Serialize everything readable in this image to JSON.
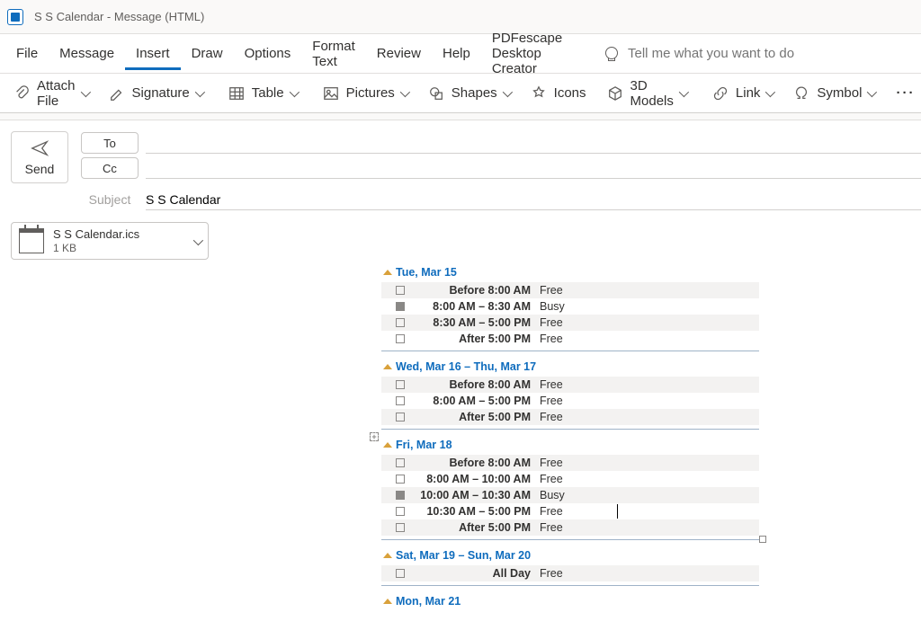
{
  "titlebar": {
    "text": "S S Calendar  -  Message (HTML)"
  },
  "menu": {
    "file": "File",
    "message": "Message",
    "insert": "Insert",
    "draw": "Draw",
    "options": "Options",
    "format_text": "Format Text",
    "review": "Review",
    "help": "Help",
    "pdfescape": "PDFescape Desktop Creator",
    "tellme_placeholder": "Tell me what you want to do"
  },
  "ribbon": {
    "attach_file": "Attach File",
    "signature": "Signature",
    "table": "Table",
    "pictures": "Pictures",
    "shapes": "Shapes",
    "icons": "Icons",
    "models_3d": "3D Models",
    "link": "Link",
    "symbol": "Symbol"
  },
  "compose": {
    "send": "Send",
    "to": "To",
    "cc": "Cc",
    "subject_label": "Subject",
    "subject_value": "S S Calendar"
  },
  "attachment": {
    "name": "S S Calendar.ics",
    "size": "1 KB"
  },
  "calendar": {
    "days": [
      {
        "header": "Tue, Mar 15",
        "cut_top": true,
        "rows": [
          {
            "time": "Before 8:00 AM",
            "status": "Free",
            "filled": false,
            "zebra": true
          },
          {
            "time": "8:00 AM – 8:30 AM",
            "status": "Busy",
            "filled": true,
            "zebra": false
          },
          {
            "time": "8:30 AM – 5:00 PM",
            "status": "Free",
            "filled": false,
            "zebra": true
          },
          {
            "time": "After 5:00 PM",
            "status": "Free",
            "filled": false,
            "zebra": false
          }
        ]
      },
      {
        "header": "Wed, Mar 16 – Thu, Mar 17",
        "rows": [
          {
            "time": "Before 8:00 AM",
            "status": "Free",
            "filled": false,
            "zebra": true
          },
          {
            "time": "8:00 AM – 5:00 PM",
            "status": "Free",
            "filled": false,
            "zebra": false
          },
          {
            "time": "After 5:00 PM",
            "status": "Free",
            "filled": false,
            "zebra": true
          }
        ]
      },
      {
        "header": "Fri, Mar 18",
        "show_plus": true,
        "rows": [
          {
            "time": "Before 8:00 AM",
            "status": "Free",
            "filled": false,
            "zebra": true
          },
          {
            "time": "8:00 AM – 10:00 AM",
            "status": "Free",
            "filled": false,
            "zebra": false
          },
          {
            "time": "10:00 AM – 10:30 AM",
            "status": "Busy",
            "filled": true,
            "zebra": true
          },
          {
            "time": "10:30 AM – 5:00 PM",
            "status": "Free",
            "filled": false,
            "zebra": false
          },
          {
            "time": "After 5:00 PM",
            "status": "Free",
            "filled": false,
            "zebra": true
          }
        ],
        "caret": true,
        "drag_handle": true
      },
      {
        "header": "Sat, Mar 19 – Sun, Mar 20",
        "rows": [
          {
            "time": "All Day",
            "status": "Free",
            "filled": false,
            "zebra": true
          }
        ]
      },
      {
        "header": "Mon, Mar 21",
        "rows": []
      }
    ]
  }
}
